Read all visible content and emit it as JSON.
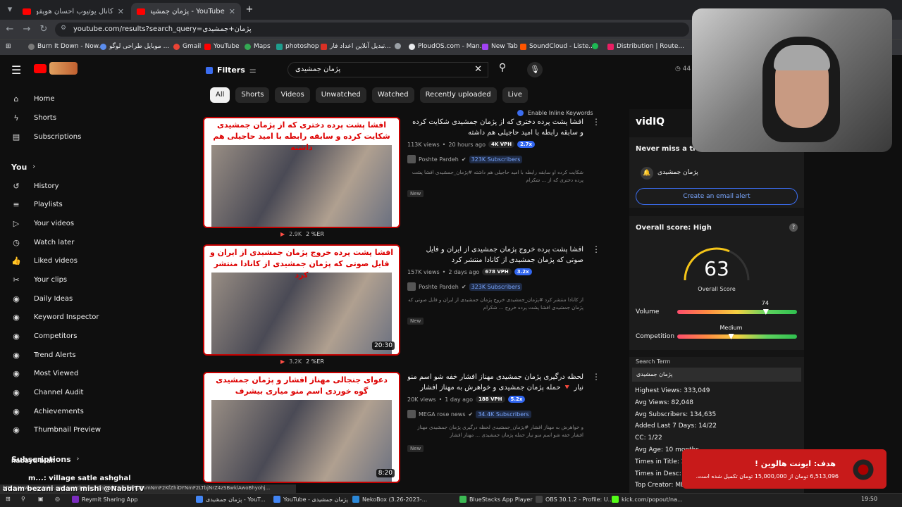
{
  "browser": {
    "tabs": [
      {
        "title": "کانال یوتیوب احسان هوپفول توت...",
        "active": false
      },
      {
        "title": "YouTube - پژمان جمشیدی",
        "active": true
      }
    ],
    "url": "youtube.com/results?search_query=پژمان+جمشیدی",
    "bookmarks": [
      "Burn It Down - Now...",
      "موبایل طراحی لوگو ...",
      "Gmail",
      "YouTube",
      "Maps",
      "photoshop",
      "تبدیل آنلاین اعداد فار...",
      "PloudOS.com - Man...",
      "New Tab",
      "SoundCloud - Liste...",
      "Distribution | Route..."
    ]
  },
  "youtube": {
    "search_value": "پژمان جمشیدی",
    "filters_label": "Filters",
    "chips": [
      "All",
      "Shorts",
      "Videos",
      "Unwatched",
      "Watched",
      "Recently uploaded",
      "Live"
    ],
    "inline_keywords_label": "Enable Inline Keywords",
    "sidebar": [
      {
        "label": "Home",
        "icon": "home-icon",
        "glyph": "⌂"
      },
      {
        "label": "Shorts",
        "icon": "shorts-icon",
        "glyph": "ϟ"
      },
      {
        "label": "Subscriptions",
        "icon": "subscriptions-icon",
        "glyph": "▤"
      },
      {
        "label": "You",
        "icon": "chevron-right-icon",
        "glyph": ">"
      },
      {
        "label": "History",
        "icon": "history-icon",
        "glyph": "↺"
      },
      {
        "label": "Playlists",
        "icon": "playlists-icon",
        "glyph": "≡"
      },
      {
        "label": "Your videos",
        "icon": "your-videos-icon",
        "glyph": "▷"
      },
      {
        "label": "Watch later",
        "icon": "watch-later-icon",
        "glyph": "◷"
      },
      {
        "label": "Liked videos",
        "icon": "like-icon",
        "glyph": "👍"
      },
      {
        "label": "Your clips",
        "icon": "scissors-icon",
        "glyph": "✂"
      },
      {
        "label": "Daily Ideas",
        "icon": "vidiq-icon",
        "glyph": "◉"
      },
      {
        "label": "Keyword Inspector",
        "icon": "vidiq-icon",
        "glyph": "◉"
      },
      {
        "label": "Competitors",
        "icon": "vidiq-icon",
        "glyph": "◉"
      },
      {
        "label": "Trend Alerts",
        "icon": "vidiq-icon",
        "glyph": "◉"
      },
      {
        "label": "Most Viewed",
        "icon": "vidiq-icon",
        "glyph": "◉"
      },
      {
        "label": "Channel Audit",
        "icon": "vidiq-icon",
        "glyph": "◉"
      },
      {
        "label": "Achievements",
        "icon": "vidiq-icon",
        "glyph": "◉"
      },
      {
        "label": "Thumbnail Preview",
        "icon": "vidiq-icon",
        "glyph": "◉"
      },
      {
        "label": "Subscriptions",
        "icon": "chevron-right-icon",
        "glyph": ">"
      }
    ],
    "videos": [
      {
        "thumb_text": "افشا پشت پرده دختری که از پژمان جمشیدی شکایت کرده و سابقه رابطه با امید حاجیلی هم داشته",
        "title": "افشا پشت پرده دختری که از پژمان جمشیدی شکایت کرده و سابقه رابطه با امید حاجیلی هم داشته",
        "views": "113K views",
        "age": "20 hours ago",
        "vph": "4K VPH",
        "mult": "2.7x",
        "channel": "Poshte Pardeh",
        "subs": "323K Subscribers",
        "desc": "شکایت کرده او سابقه رابطه با امید حاجیلی هم داشته #پژمان_جمشیدی افشا پشت پرده دختری که از ... شکرام",
        "badge": "New",
        "duration": "",
        "like_stat": "2.9K",
        "er": "2 %ER"
      },
      {
        "thumb_text": "افشا پشت پرده خروج پژمان جمشیدی از ایران و فایل صوتی که پژمان جمشیدی از کانادا منتشر کرد",
        "title": "افشا پشت پرده خروج پژمان جمشیدی از ایران و فایل صوتی که پژمان جمشیدی از کانادا منتشر کرد",
        "views": "157K views",
        "age": "2 days ago",
        "vph": "678 VPH",
        "mult": "3.2x",
        "channel": "Poshte Pardeh",
        "subs": "323K Subscribers",
        "desc": "از کانادا منتشر کرد #پژمان_جمشیدی خروج پژمان جمشیدی از ایران و فایل صوتی که پژمان جمشیدی افشا پشت پرده خروج ... شکرام",
        "badge": "New",
        "duration": "20:30",
        "like_stat": "3.2K",
        "er": "2 %ER"
      },
      {
        "thumb_text": "دعوای جنجالی مهناز افشار و پژمان جمشیدی گوه خوردی اسم منو میاری بیشرف",
        "title": "لحظه درگیری پژمان جمشیدی مهناز افشار خفه شو اسم منو نیار 🔻 حمله پژمان جمشیدی و خواهرش به مهناز افشار",
        "views": "20K views",
        "age": "1 day ago",
        "vph": "188 VPH",
        "mult": "5.2x",
        "channel": "MEGA rose news",
        "subs": "34.4K Subscribers",
        "desc": "و خواهرش به مهناز افشار #پژمان_جمشیدی لحظه درگیری پژمان جمشیدی مهناز افشار خفه شو اسم منو نیار حمله پژمان جمشیدی ... مهناز افشار",
        "badge": "New",
        "duration": "8:20",
        "like_stat": "",
        "er": ""
      }
    ]
  },
  "vidiq": {
    "logo": "vidIQ",
    "never_miss": "Never miss a tre",
    "keyword": "پژمان جمشیدی",
    "email_btn": "Create an email alert",
    "overall_label": "Overall score: High",
    "score": "63",
    "score_label": "Overall Score",
    "volume_label": "Volume",
    "volume_value": "74",
    "volume_level": 0.74,
    "competition_label": "Competition",
    "competition_value": "Medium",
    "competition_level": 0.45,
    "search_term_label": "Search Term",
    "search_term": "پژمان جمشیدی",
    "stats": [
      "Highest Views: 333,049",
      "Avg Views: 82,048",
      "Avg Subscribers: 134,635",
      "Added Last 7 Days: 14/22",
      "CC: 1/22",
      "Avg Age: 10 months",
      "Times in Title: 2",
      "Times in Desc: 0",
      "Top Creator: ME"
    ]
  },
  "overlay": {
    "alert_title": "هدف: ایونت هالوین !",
    "alert_sub": "6,513,096 تومان از 15,000,000 تومان تکمیل شده است.",
    "chat_line1": "nabayd bian",
    "chat_line2": "m...: village satle ashghal",
    "chat_line3": "adam bezani adam mishi @NabbiTV",
    "status_url": "https://www.youtube.com/watch?v=...Cpjt4dM6yu48Hb7amNmF2KfZhiDYNmF2LTbjNrZ4zSBwklAwoBhyohj..."
  },
  "taskbar": {
    "items": [
      "Reymit Sharing App",
      "پژمان جمشیدی - YouT...",
      "YouTube - پژمان جمشیدی",
      "NekoBox (3.26-2023-...",
      "BlueStacks App Player",
      "OBS 30.1.2 - Profile: U...",
      "kick.com/popout/na..."
    ],
    "clock": "19:50"
  }
}
